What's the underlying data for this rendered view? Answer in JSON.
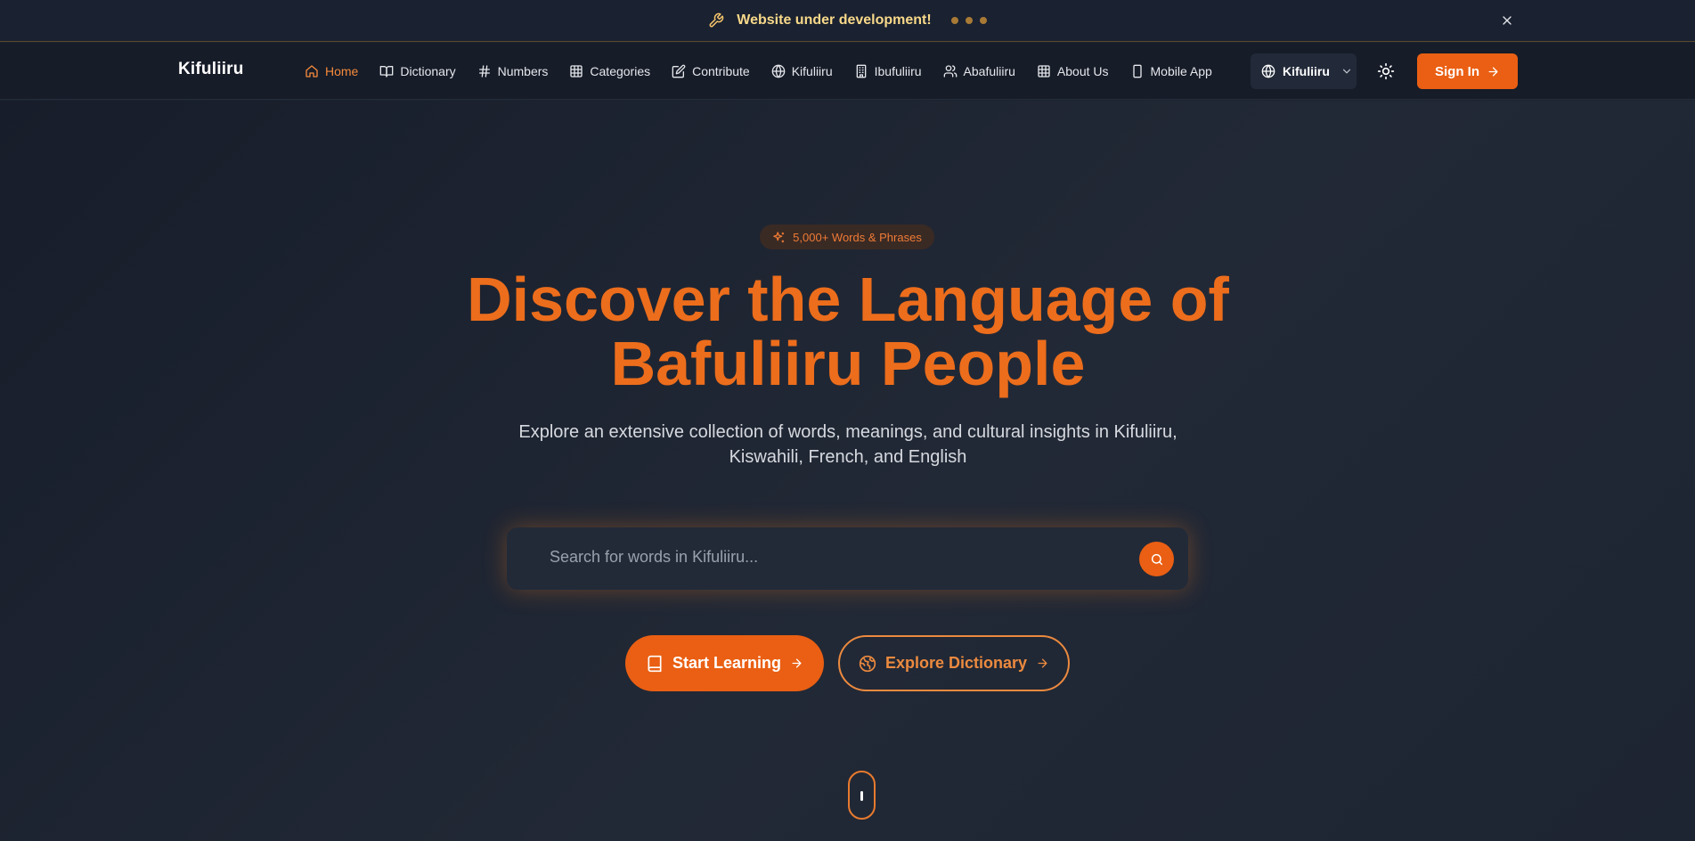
{
  "announcement": {
    "message": "Website under development!",
    "icon": "wrench-icon",
    "close_icon": "close-icon"
  },
  "nav": {
    "brand": "Kifuliiru",
    "links": [
      {
        "label": "Home",
        "icon": "home-icon",
        "active": true
      },
      {
        "label": "Dictionary",
        "icon": "book-open-icon"
      },
      {
        "label": "Numbers",
        "icon": "hash-icon"
      },
      {
        "label": "Categories",
        "icon": "grid-icon"
      },
      {
        "label": "Contribute",
        "icon": "edit-icon"
      },
      {
        "label": "Kifuliiru",
        "icon": "globe-icon"
      },
      {
        "label": "Ibufuliiru",
        "icon": "building-icon"
      },
      {
        "label": "Abafuliiru",
        "icon": "users-icon"
      },
      {
        "label": "About Us",
        "icon": "grid-icon"
      },
      {
        "label": "Mobile App",
        "icon": "smartphone-icon"
      }
    ],
    "language_selected": "Kifuliiru",
    "sign_in_label": "Sign In"
  },
  "hero": {
    "badge": "5,000+ Words & Phrases",
    "title_line1": "Discover the Language of",
    "title_line2": "Bafuliiru People",
    "subtitle_line1": "Explore an extensive collection of words, meanings, and cultural insights in Kifuliiru,",
    "subtitle_line2": "Kiswahili, French, and English",
    "search_placeholder": "Search for words in Kifuliiru...",
    "start_learning_label": "Start Learning",
    "explore_dictionary_label": "Explore Dictionary"
  },
  "colors": {
    "accent": "#ea5f13",
    "accent_text": "#ec6d1c",
    "announcement_text": "#f8d98a",
    "background": "#1b2230"
  }
}
